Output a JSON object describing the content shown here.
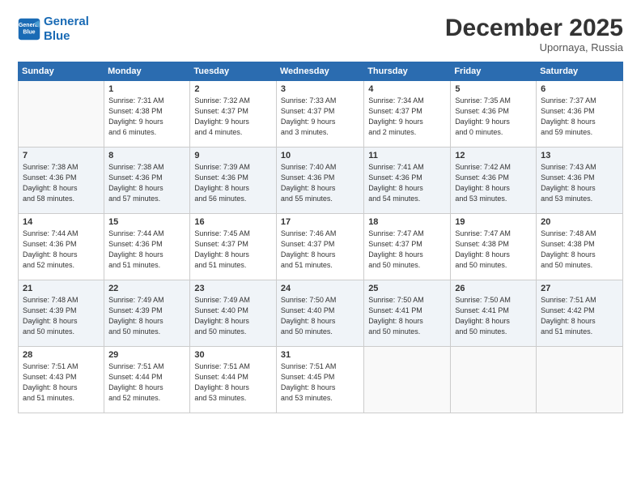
{
  "header": {
    "logo_line1": "General",
    "logo_line2": "Blue",
    "month": "December 2025",
    "location": "Upornaya, Russia"
  },
  "days_of_week": [
    "Sunday",
    "Monday",
    "Tuesday",
    "Wednesday",
    "Thursday",
    "Friday",
    "Saturday"
  ],
  "weeks": [
    [
      {
        "day": "",
        "info": ""
      },
      {
        "day": "1",
        "info": "Sunrise: 7:31 AM\nSunset: 4:38 PM\nDaylight: 9 hours\nand 6 minutes."
      },
      {
        "day": "2",
        "info": "Sunrise: 7:32 AM\nSunset: 4:37 PM\nDaylight: 9 hours\nand 4 minutes."
      },
      {
        "day": "3",
        "info": "Sunrise: 7:33 AM\nSunset: 4:37 PM\nDaylight: 9 hours\nand 3 minutes."
      },
      {
        "day": "4",
        "info": "Sunrise: 7:34 AM\nSunset: 4:37 PM\nDaylight: 9 hours\nand 2 minutes."
      },
      {
        "day": "5",
        "info": "Sunrise: 7:35 AM\nSunset: 4:36 PM\nDaylight: 9 hours\nand 0 minutes."
      },
      {
        "day": "6",
        "info": "Sunrise: 7:37 AM\nSunset: 4:36 PM\nDaylight: 8 hours\nand 59 minutes."
      }
    ],
    [
      {
        "day": "7",
        "info": "Sunrise: 7:38 AM\nSunset: 4:36 PM\nDaylight: 8 hours\nand 58 minutes."
      },
      {
        "day": "8",
        "info": "Sunrise: 7:38 AM\nSunset: 4:36 PM\nDaylight: 8 hours\nand 57 minutes."
      },
      {
        "day": "9",
        "info": "Sunrise: 7:39 AM\nSunset: 4:36 PM\nDaylight: 8 hours\nand 56 minutes."
      },
      {
        "day": "10",
        "info": "Sunrise: 7:40 AM\nSunset: 4:36 PM\nDaylight: 8 hours\nand 55 minutes."
      },
      {
        "day": "11",
        "info": "Sunrise: 7:41 AM\nSunset: 4:36 PM\nDaylight: 8 hours\nand 54 minutes."
      },
      {
        "day": "12",
        "info": "Sunrise: 7:42 AM\nSunset: 4:36 PM\nDaylight: 8 hours\nand 53 minutes."
      },
      {
        "day": "13",
        "info": "Sunrise: 7:43 AM\nSunset: 4:36 PM\nDaylight: 8 hours\nand 53 minutes."
      }
    ],
    [
      {
        "day": "14",
        "info": "Sunrise: 7:44 AM\nSunset: 4:36 PM\nDaylight: 8 hours\nand 52 minutes."
      },
      {
        "day": "15",
        "info": "Sunrise: 7:44 AM\nSunset: 4:36 PM\nDaylight: 8 hours\nand 51 minutes."
      },
      {
        "day": "16",
        "info": "Sunrise: 7:45 AM\nSunset: 4:37 PM\nDaylight: 8 hours\nand 51 minutes."
      },
      {
        "day": "17",
        "info": "Sunrise: 7:46 AM\nSunset: 4:37 PM\nDaylight: 8 hours\nand 51 minutes."
      },
      {
        "day": "18",
        "info": "Sunrise: 7:47 AM\nSunset: 4:37 PM\nDaylight: 8 hours\nand 50 minutes."
      },
      {
        "day": "19",
        "info": "Sunrise: 7:47 AM\nSunset: 4:38 PM\nDaylight: 8 hours\nand 50 minutes."
      },
      {
        "day": "20",
        "info": "Sunrise: 7:48 AM\nSunset: 4:38 PM\nDaylight: 8 hours\nand 50 minutes."
      }
    ],
    [
      {
        "day": "21",
        "info": "Sunrise: 7:48 AM\nSunset: 4:39 PM\nDaylight: 8 hours\nand 50 minutes."
      },
      {
        "day": "22",
        "info": "Sunrise: 7:49 AM\nSunset: 4:39 PM\nDaylight: 8 hours\nand 50 minutes."
      },
      {
        "day": "23",
        "info": "Sunrise: 7:49 AM\nSunset: 4:40 PM\nDaylight: 8 hours\nand 50 minutes."
      },
      {
        "day": "24",
        "info": "Sunrise: 7:50 AM\nSunset: 4:40 PM\nDaylight: 8 hours\nand 50 minutes."
      },
      {
        "day": "25",
        "info": "Sunrise: 7:50 AM\nSunset: 4:41 PM\nDaylight: 8 hours\nand 50 minutes."
      },
      {
        "day": "26",
        "info": "Sunrise: 7:50 AM\nSunset: 4:41 PM\nDaylight: 8 hours\nand 50 minutes."
      },
      {
        "day": "27",
        "info": "Sunrise: 7:51 AM\nSunset: 4:42 PM\nDaylight: 8 hours\nand 51 minutes."
      }
    ],
    [
      {
        "day": "28",
        "info": "Sunrise: 7:51 AM\nSunset: 4:43 PM\nDaylight: 8 hours\nand 51 minutes."
      },
      {
        "day": "29",
        "info": "Sunrise: 7:51 AM\nSunset: 4:44 PM\nDaylight: 8 hours\nand 52 minutes."
      },
      {
        "day": "30",
        "info": "Sunrise: 7:51 AM\nSunset: 4:44 PM\nDaylight: 8 hours\nand 53 minutes."
      },
      {
        "day": "31",
        "info": "Sunrise: 7:51 AM\nSunset: 4:45 PM\nDaylight: 8 hours\nand 53 minutes."
      },
      {
        "day": "",
        "info": ""
      },
      {
        "day": "",
        "info": ""
      },
      {
        "day": "",
        "info": ""
      }
    ]
  ]
}
